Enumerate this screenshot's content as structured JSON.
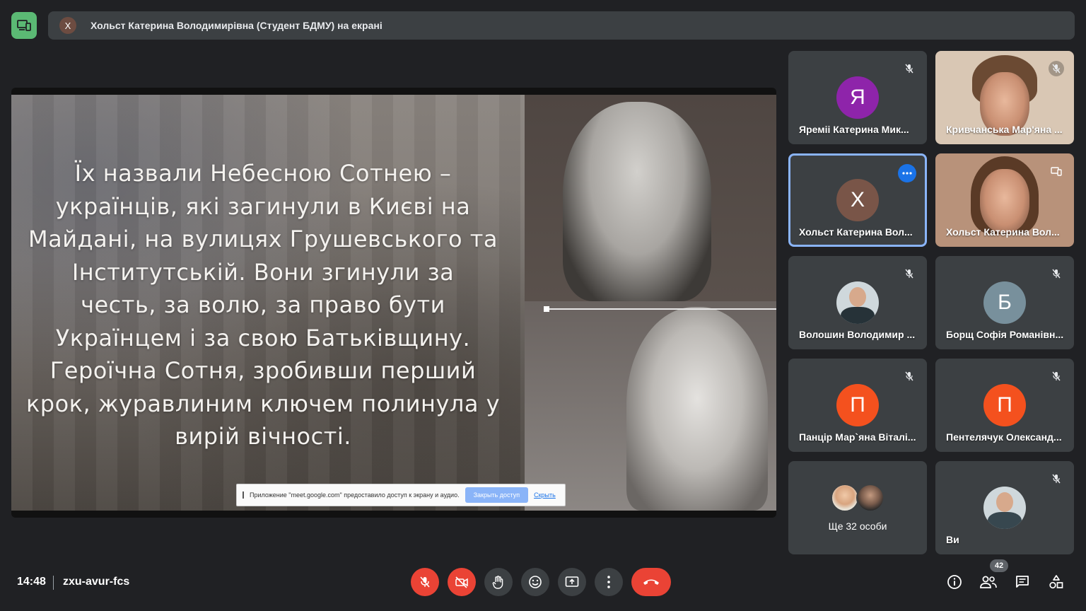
{
  "presenting": {
    "avatar_letter": "Х",
    "text": "Хольст Катерина Володимирівна (Студент БДМУ) на екрані"
  },
  "slide": {
    "lines": [
      "Їх назвали Небесною Сотнею –",
      "українців, які загинули в Києві на",
      "Майдані, на вулицях Грушевського та",
      "Інститутській. Вони згинули за",
      "честь, за волю, за право бути",
      "Українцем і за свою Батьківщину.",
      "Героїчна Сотня, зробивши перший",
      "крок, журавлиним ключем полинула у",
      "вирій вічності."
    ]
  },
  "share_notice": {
    "text": "Приложение \"meet.google.com\" предоставило доступ к экрану и аудио.",
    "stop_label": "Закрыть доступ",
    "hide_label": "Скрыть"
  },
  "participants": [
    {
      "name": "Яреміі Катерина Мик...",
      "letter": "Я",
      "color": "#8e24aa",
      "muted": true
    },
    {
      "name": "Кривчанська Мар'яна ...",
      "letter": "",
      "color": "",
      "muted": true
    },
    {
      "name": "Хольст Катерина Вол...",
      "letter": "Х",
      "color": "#795548",
      "muted": false
    },
    {
      "name": "Хольст Катерина Вол...",
      "letter": "",
      "color": "",
      "muted": false
    },
    {
      "name": "Волошин Володимир ...",
      "letter": "",
      "color": "",
      "muted": true
    },
    {
      "name": "Борщ Софія Романівн...",
      "letter": "Б",
      "color": "#78909c",
      "muted": true
    },
    {
      "name": "Панцір Мар`яна Віталі...",
      "letter": "П",
      "color": "#f4511e",
      "muted": true
    },
    {
      "name": "Пентелячук Олександ...",
      "letter": "П",
      "color": "#f4511e",
      "muted": true
    },
    {
      "name": "Ще 32 особи",
      "letter": "",
      "color": "",
      "muted": false
    },
    {
      "name": "Ви",
      "letter": "",
      "color": "",
      "muted": true
    }
  ],
  "meeting": {
    "time": "14:48",
    "code": "zxu-avur-fcs",
    "people_count": "42"
  }
}
